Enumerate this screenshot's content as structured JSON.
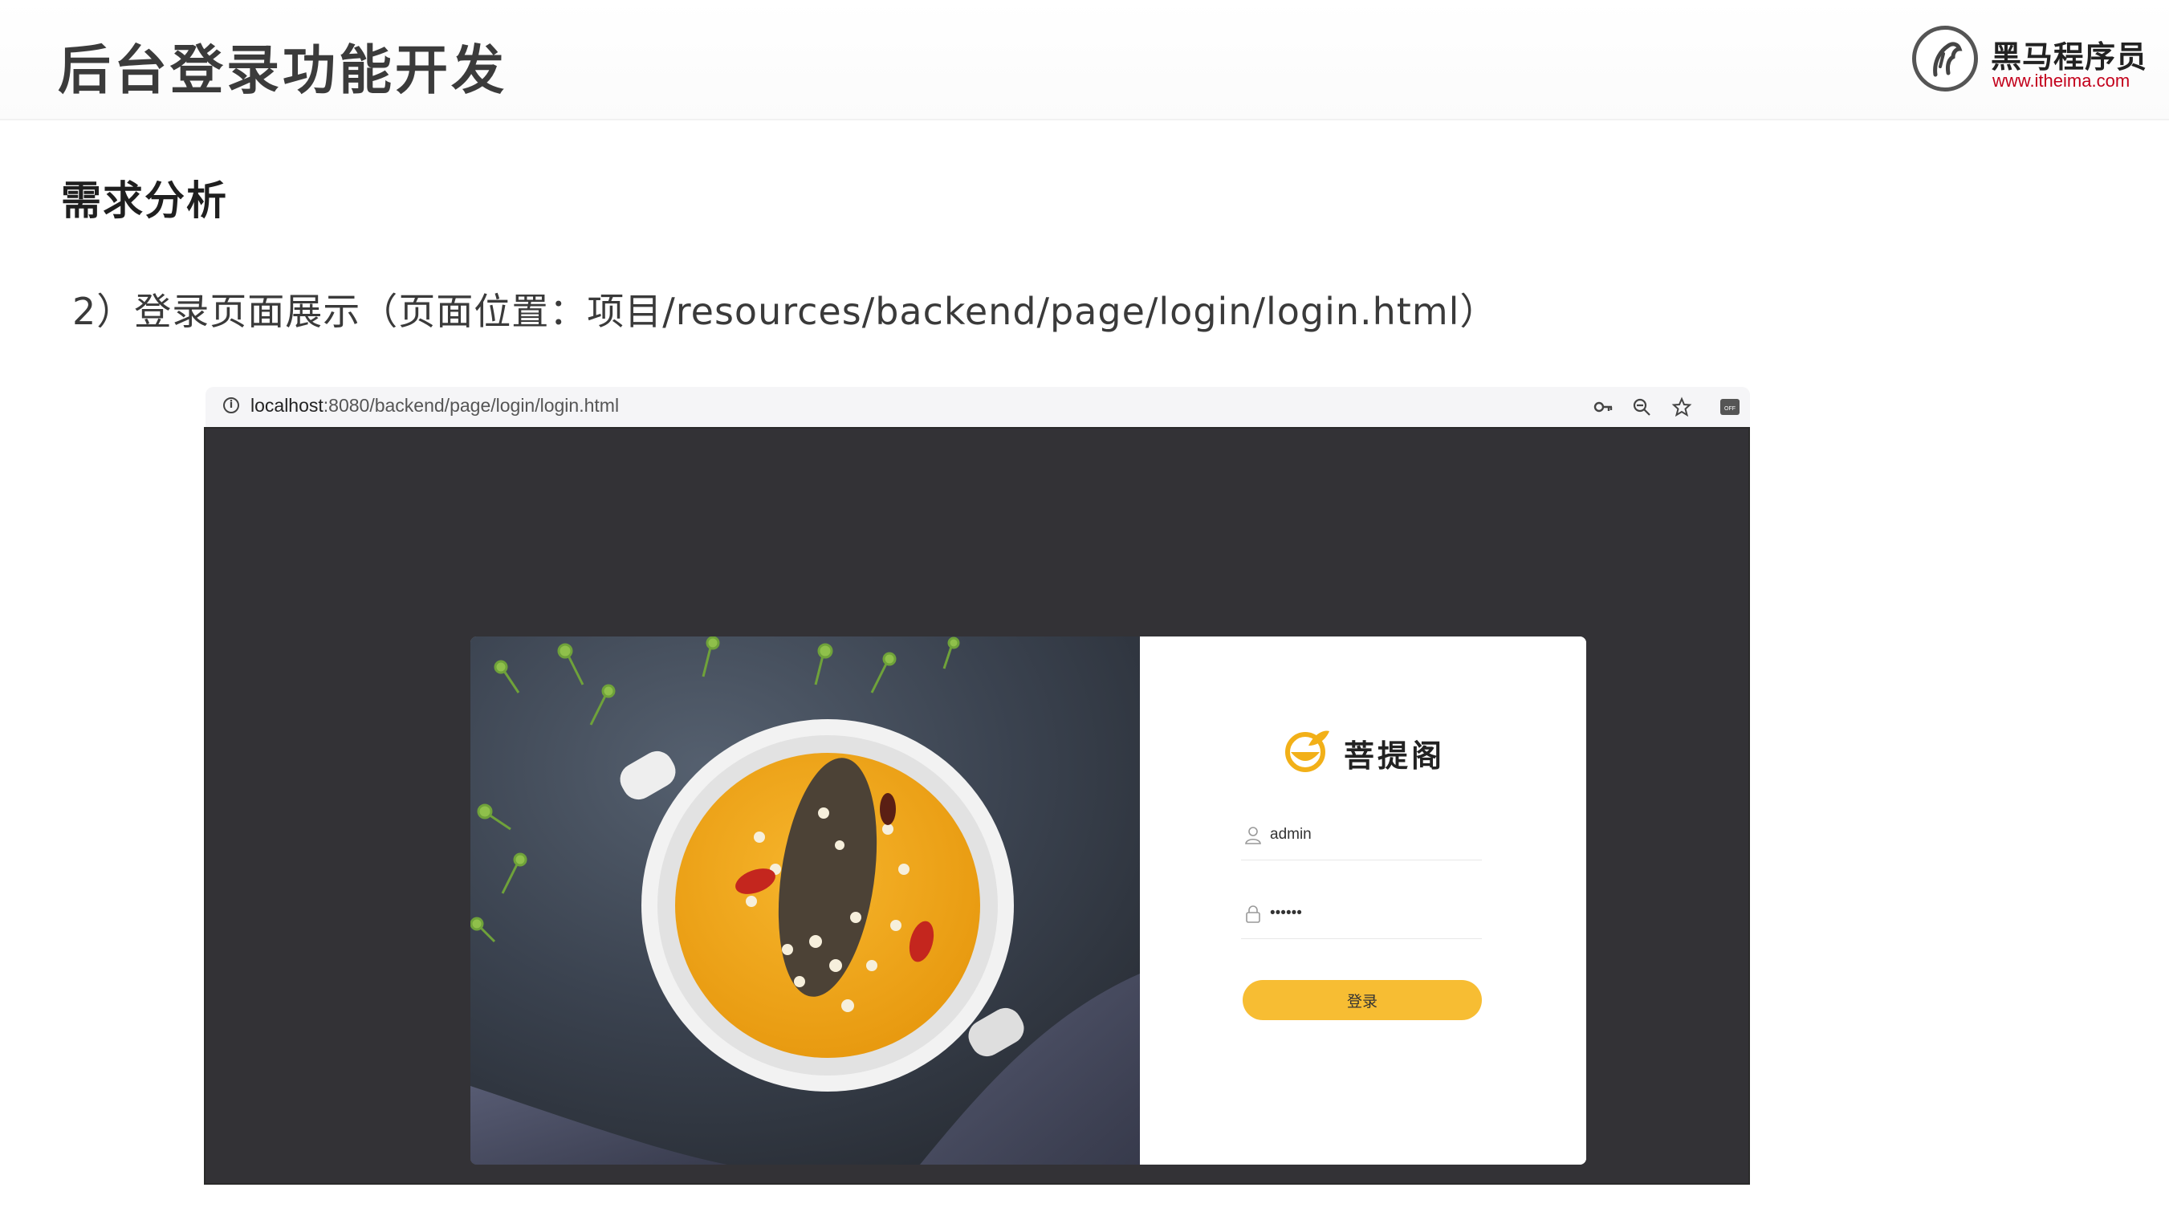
{
  "slide": {
    "title": "后台登录功能开发",
    "brand": {
      "name": "黑马程序员",
      "url": "www.itheima.com"
    },
    "section_title": "需求分析",
    "subtitle": "2）登录页面展示（页面位置：项目/resources/backend/page/login/login.html）"
  },
  "browser": {
    "url_host": "localhost",
    "url_rest": ":8080/backend/page/login/login.html",
    "icons": [
      "info-icon",
      "key-icon",
      "zoom-icon",
      "star-icon",
      "extension-icon"
    ],
    "extension_badge": "OFF"
  },
  "login_page": {
    "logo_text": "菩提阁",
    "username_value": "admin",
    "password_value": "••••••",
    "login_button_label": "登录",
    "accent_color": "#f7bd33",
    "background_color": "#333236"
  }
}
